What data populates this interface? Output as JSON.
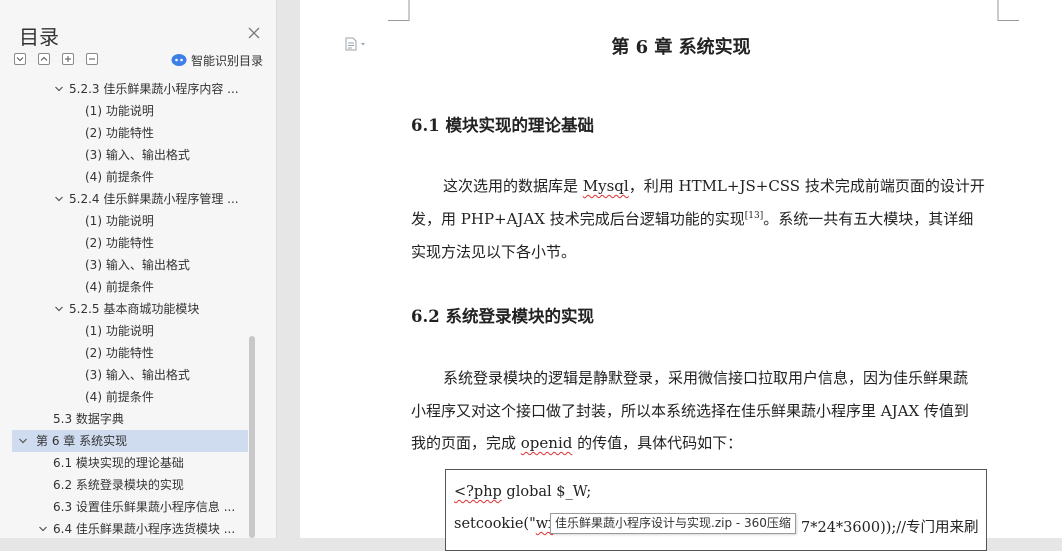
{
  "sidebar": {
    "title": "目录",
    "smart_toc_label": "智能识别目录",
    "toc": [
      {
        "text": "5.2.3  佳乐鲜果蔬小程序内容 ...",
        "level": 2,
        "expanded": true
      },
      {
        "text": "(1)  功能说明",
        "level": 3
      },
      {
        "text": "(2)  功能特性",
        "level": 3
      },
      {
        "text": "(3)  输入、输出格式",
        "level": 3
      },
      {
        "text": "(4)  前提条件",
        "level": 3
      },
      {
        "text": "5.2.4  佳乐鲜果蔬小程序管理 ...",
        "level": 2,
        "expanded": true
      },
      {
        "text": "(1)  功能说明",
        "level": 3
      },
      {
        "text": "(2)  功能特性",
        "level": 3
      },
      {
        "text": "(3)  输入、输出格式",
        "level": 3
      },
      {
        "text": "(4)  前提条件",
        "level": 3
      },
      {
        "text": "5.2.5  基本商城功能模块",
        "level": 2,
        "expanded": true
      },
      {
        "text": "(1)  功能说明",
        "level": 3
      },
      {
        "text": "(2)  功能特性",
        "level": 3
      },
      {
        "text": "(3)  输入、输出格式",
        "level": 3
      },
      {
        "text": "(4)  前提条件",
        "level": 3
      },
      {
        "text": "5.3  数据字典",
        "level": 1
      },
      {
        "text": "第 6 章  系统实现",
        "level": 0,
        "expanded": true,
        "selected": true
      },
      {
        "text": "6.1  模块实现的理论基础",
        "level": 1
      },
      {
        "text": "6.2  系统登录模块的实现",
        "level": 1
      },
      {
        "text": "6.3  设置佳乐鲜果蔬小程序信息 ...",
        "level": 1
      },
      {
        "text": "6.4  佳乐鲜果蔬小程序选货模块 ...",
        "level": 1,
        "expanded": true
      }
    ]
  },
  "document": {
    "chapter_title": "第 6 章  系统实现",
    "sec1_title": "6.1  模块实现的理论基础",
    "p1": {
      "l1_a": "这次选用的数据库是 ",
      "l1_b": "Mysql",
      "l1_c": "，利用 HTML+JS+CSS 技术完成前端页面的设计开",
      "l2_a": "发，用 PHP+AJAX 技术完成后台逻辑功能的实现",
      "l2_sup": "[13]",
      "l2_b": "。系统一共有五大模块，其详细",
      "l3": "实现方法见以下各小节。"
    },
    "sec2_title": "6.2  系统登录模块的实现",
    "p2": {
      "l1": "系统登录模块的逻辑是静默登录，采用微信接口拉取用户信息，因为佳乐鲜果蔬",
      "l2": "小程序又对这个接口做了封装，所以本系统选择在佳乐鲜果蔬小程序里 AJAX 传值到",
      "l3_a": "我的页面，完成 ",
      "l3_b": "openid",
      "l3_c": " 的传值，具体代码如下："
    },
    "code": {
      "l1_a": "<?php",
      "l1_b": "   global $_W;",
      "l2_a": "setcookie(\"",
      "l2_b": "wx",
      "l2_c": "7*24*3600));//专门用来刷"
    }
  },
  "tooltip": {
    "text": "佳乐鲜果蔬小程序设计与实现.zip - 360压缩"
  }
}
